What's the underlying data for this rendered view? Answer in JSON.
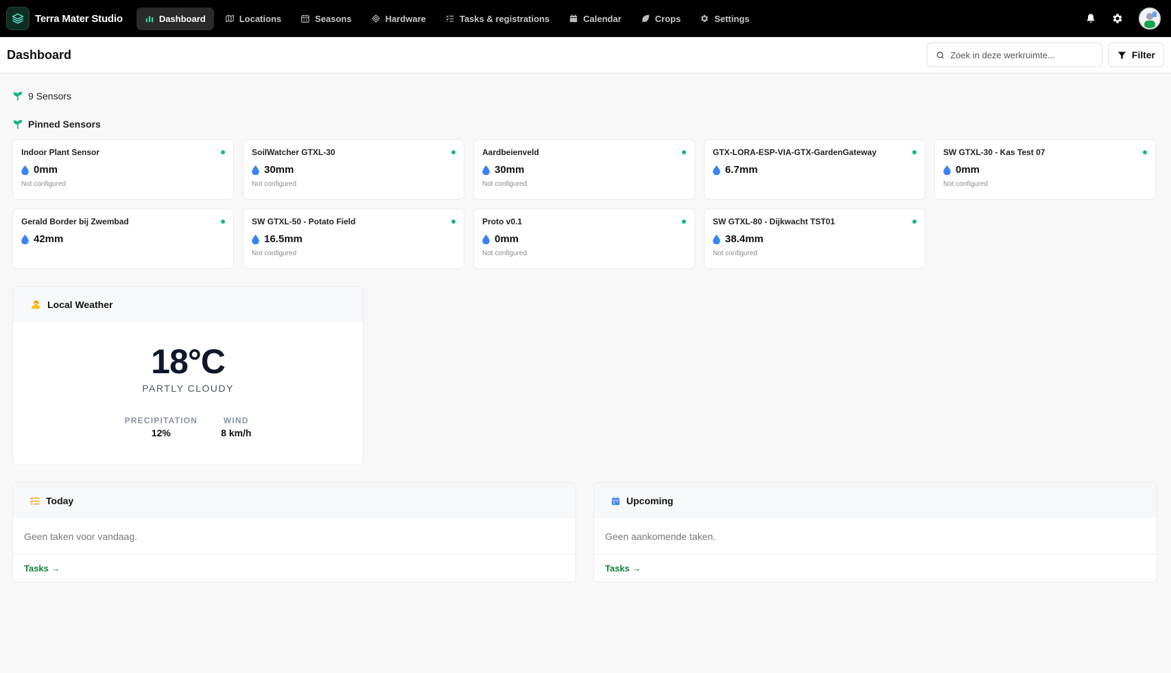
{
  "app": {
    "name": "Terra Mater Studio"
  },
  "nav": {
    "items": [
      {
        "label": "Dashboard",
        "icon": "bar-chart-icon",
        "active": true
      },
      {
        "label": "Locations",
        "icon": "map-icon"
      },
      {
        "label": "Seasons",
        "icon": "calendar-grid-icon"
      },
      {
        "label": "Hardware",
        "icon": "chip-icon"
      },
      {
        "label": "Tasks & registrations",
        "icon": "list-check-icon"
      },
      {
        "label": "Calendar",
        "icon": "calendar-icon"
      },
      {
        "label": "Crops",
        "icon": "leaf-icon"
      },
      {
        "label": "Settings",
        "icon": "gear-icon"
      }
    ]
  },
  "header": {
    "title": "Dashboard",
    "search_placeholder": "Zoek in deze werkruimte...",
    "filter_label": "Filter"
  },
  "sensors": {
    "count_label": "9 Sensors",
    "pinned_label": "Pinned Sensors",
    "items": [
      {
        "name": "Indoor Plant Sensor",
        "value": "0mm",
        "note": "Not configured"
      },
      {
        "name": "SoilWatcher GTXL-30",
        "value": "30mm",
        "note": "Not configured"
      },
      {
        "name": "Aardbeienveld",
        "value": "30mm",
        "note": "Not configured"
      },
      {
        "name": "GTX-LORA-ESP-VIA-GTX-GardenGateway",
        "value": "6.7mm",
        "note": ""
      },
      {
        "name": "SW GTXL-30 - Kas Test 07",
        "value": "0mm",
        "note": "Not configured"
      },
      {
        "name": "Gerald Border bij Zwembad",
        "value": "42mm",
        "note": ""
      },
      {
        "name": "SW GTXL-50 - Potato Field",
        "value": "16.5mm",
        "note": "Not configured"
      },
      {
        "name": "Proto v0.1",
        "value": "0mm",
        "note": "Not configured"
      },
      {
        "name": "SW GTXL-80 - Dijkwacht TST01",
        "value": "38.4mm",
        "note": "Not configured"
      }
    ]
  },
  "weather": {
    "title": "Local Weather",
    "temperature": "18°C",
    "condition": "PARTLY CLOUDY",
    "precipitation_label": "PRECIPITATION",
    "precipitation_value": "12%",
    "wind_label": "WIND",
    "wind_value": "8 km/h"
  },
  "today": {
    "title": "Today",
    "empty_text": "Geen taken voor vandaag.",
    "link_label": "Tasks →"
  },
  "upcoming": {
    "title": "Upcoming",
    "empty_text": "Geen aankomende taken.",
    "link_label": "Tasks →"
  },
  "colors": {
    "accent_green": "#10b981",
    "link_green": "#15803d",
    "drop_blue": "#3b82f6",
    "weather_orange": "#f59e0b"
  }
}
